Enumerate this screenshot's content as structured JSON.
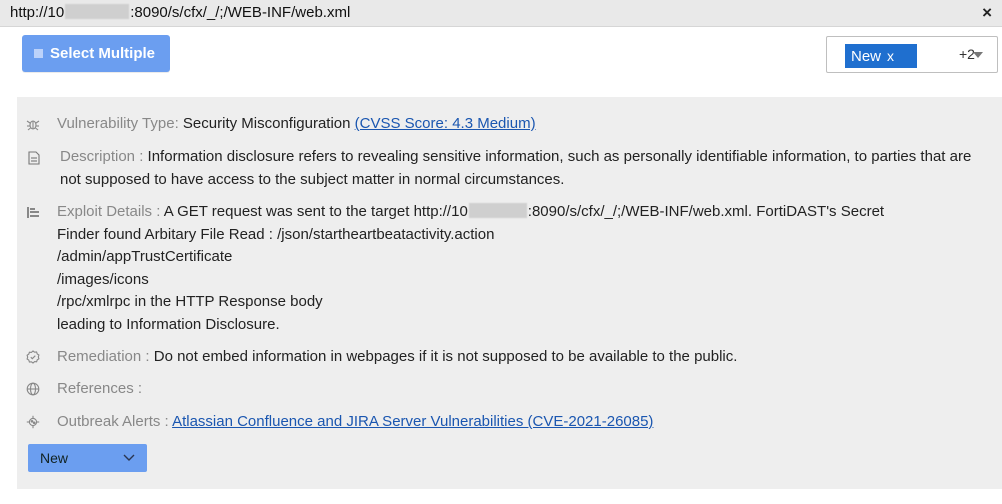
{
  "header": {
    "url_prefix": "http://10",
    "url_suffix": ":8090/s/cfx/_/;/WEB-INF/web.xml",
    "close_label": "×"
  },
  "toolbar": {
    "select_multiple_label": "Select Multiple",
    "tag_chip_label": "New",
    "tag_chip_remove": "x",
    "tag_more": "+2"
  },
  "details": {
    "vulnerability_type_label": "Vulnerability Type:",
    "vulnerability_type_value": "Security Misconfiguration",
    "cvss_link": "(CVSS Score: 4.3 Medium)",
    "description_label": "Description :",
    "description_value": "Information disclosure refers to revealing sensitive information, such as personally identifiable information, to parties that are not supposed to have access to the subject matter in normal circumstances.",
    "exploit_label": "Exploit Details :",
    "exploit_line1_prefix": "A GET request was sent to the target http://10",
    "exploit_line1_suffix": ":8090/s/cfx/_/;/WEB-INF/web.xml. FortiDAST's Secret",
    "exploit_line2": "Finder found Arbitary File Read : /json/startheartbeatactivity.action",
    "exploit_line3": "/admin/appTrustCertificate",
    "exploit_line4": "/images/icons",
    "exploit_line5": "/rpc/xmlrpc in the HTTP Response body",
    "exploit_line6": "leading to Information Disclosure.",
    "remediation_label": "Remediation :",
    "remediation_value": "Do not embed information in webpages if it is not supposed to be available to the public.",
    "references_label": "References :",
    "outbreak_label": "Outbreak Alerts :",
    "outbreak_link": "Atlassian Confluence and JIRA Server Vulnerabilities (CVE-2021-26085)"
  },
  "status_button": {
    "label": "New",
    "chevron": "⌄"
  },
  "icons": {
    "vulnerability": "bug-icon",
    "description": "document-icon",
    "exploit": "exploit-icon",
    "remediation": "badge-icon",
    "references": "globe-icon",
    "outbreak": "virus-icon"
  },
  "colors": {
    "accent": "#6b9ef0",
    "chip": "#1f6fcf",
    "link": "#1a56b0"
  }
}
